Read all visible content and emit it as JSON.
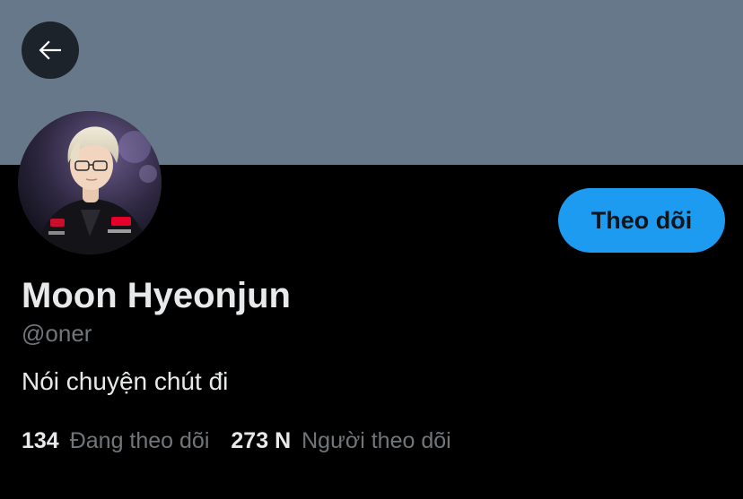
{
  "header": {
    "back_icon": "arrow-left-icon"
  },
  "profile": {
    "display_name": "Moon Hyeonjun",
    "handle": "@oner",
    "bio": "Nói chuyện chút đi",
    "avatar_icon": "profile-photo"
  },
  "actions": {
    "follow_label": "Theo dõi"
  },
  "stats": {
    "following_count": "134",
    "following_label": "Đang theo dõi",
    "followers_count": "273 N",
    "followers_label": "Người theo dõi"
  },
  "colors": {
    "banner": "#66788a",
    "background": "#000000",
    "accent": "#1d9bf0",
    "primary_text": "#e7e9ea",
    "secondary_text": "#71767b"
  }
}
